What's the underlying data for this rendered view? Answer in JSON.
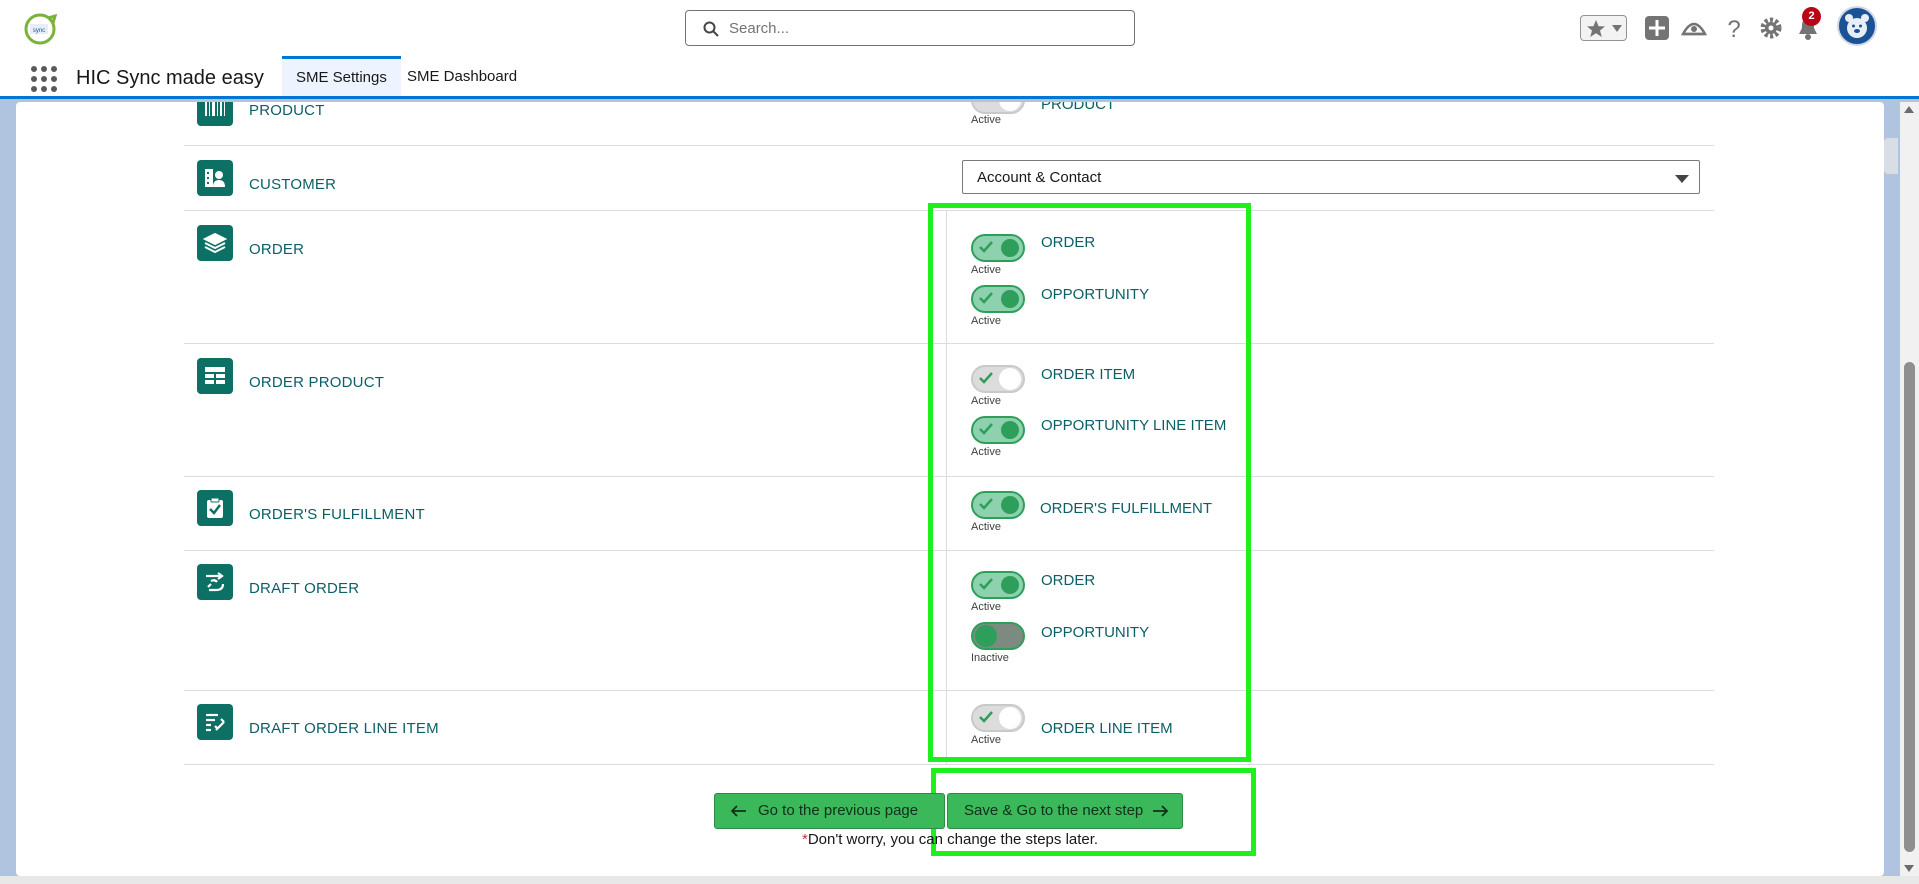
{
  "header": {
    "search_placeholder": "Search...",
    "notification_count": "2",
    "icons": [
      "favorites-icon",
      "add-icon",
      "trailhead-icon",
      "help-icon",
      "setup-gear-icon",
      "notifications-bell-icon",
      "user-avatar"
    ]
  },
  "nav": {
    "app_name": "HIC Sync made easy",
    "tabs": [
      {
        "label": "SME Settings",
        "active": true
      },
      {
        "label": "SME Dashboard",
        "active": false
      }
    ]
  },
  "rows": [
    {
      "entity": "PRODUCT",
      "icon": "barcode-icon",
      "toggles": [
        {
          "label": "PRODUCT",
          "state": "Active",
          "on": true
        }
      ]
    },
    {
      "entity": "CUSTOMER",
      "icon": "account-contact-icon",
      "select_value": "Account & Contact"
    },
    {
      "entity": "ORDER",
      "icon": "layers-icon",
      "toggles": [
        {
          "label": "ORDER",
          "state": "Active",
          "on": true
        },
        {
          "label": "OPPORTUNITY",
          "state": "Active",
          "on": true
        }
      ]
    },
    {
      "entity": "ORDER PRODUCT",
      "icon": "table-icon",
      "toggles": [
        {
          "label": "ORDER ITEM",
          "state": "Active",
          "on": false
        },
        {
          "label": "OPPORTUNITY LINE ITEM",
          "state": "Active",
          "on": true
        }
      ]
    },
    {
      "entity": "ORDER'S FULFILLMENT",
      "icon": "clipboard-check-icon",
      "toggles": [
        {
          "label": "ORDER'S FULFILLMENT",
          "state": "Active",
          "on": true
        }
      ]
    },
    {
      "entity": "DRAFT ORDER",
      "icon": "draft-order-icon",
      "toggles": [
        {
          "label": "ORDER",
          "state": "Active",
          "on": true
        },
        {
          "label": "OPPORTUNITY",
          "state": "Inactive",
          "on": false
        }
      ]
    },
    {
      "entity": "DRAFT ORDER LINE ITEM",
      "icon": "draft-line-item-icon",
      "toggles": [
        {
          "label": "ORDER LINE ITEM",
          "state": "Active",
          "on": false
        }
      ]
    }
  ],
  "buttons": {
    "previous": "Go to the previous page",
    "next": "Save & Go to the next step"
  },
  "footnote": {
    "star": "*",
    "text": "Don't worry, you can change the steps later."
  },
  "colors": {
    "highlight": "#1ef01e",
    "brand_teal": "#0d7064",
    "button_green": "#3bb85a",
    "nav_accent": "#0176d3"
  }
}
